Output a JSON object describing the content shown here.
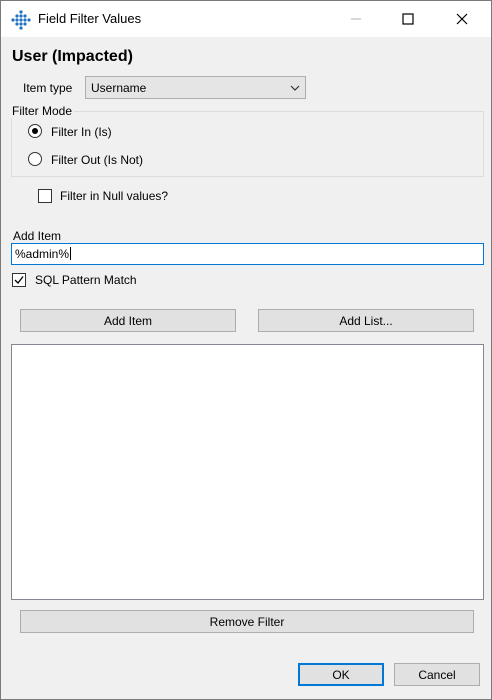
{
  "window": {
    "title": "Field Filter Values"
  },
  "heading": "User (Impacted)",
  "item_type": {
    "label": "Item type",
    "selected": "Username"
  },
  "filter_mode": {
    "legend": "Filter Mode",
    "options": [
      {
        "label": "Filter In (Is)",
        "checked": true
      },
      {
        "label": "Filter Out (Is Not)",
        "checked": false
      }
    ]
  },
  "filter_null": {
    "label": "Filter in Null values?",
    "checked": false
  },
  "add_item": {
    "label": "Add Item",
    "value": "%admin%"
  },
  "sql_pattern": {
    "label": "SQL Pattern Match",
    "checked": true
  },
  "buttons": {
    "add_item": "Add Item",
    "add_list": "Add List...",
    "remove_filter": "Remove Filter",
    "ok": "OK",
    "cancel": "Cancel"
  },
  "items_list": [],
  "icons": {
    "app": "grid-dots-icon",
    "minimize": "minimize-icon",
    "maximize": "maximize-icon",
    "close": "close-icon",
    "dropdown": "chevron-down-icon"
  },
  "colors": {
    "accent": "#0078d7",
    "app_icon": "#1e73be"
  }
}
